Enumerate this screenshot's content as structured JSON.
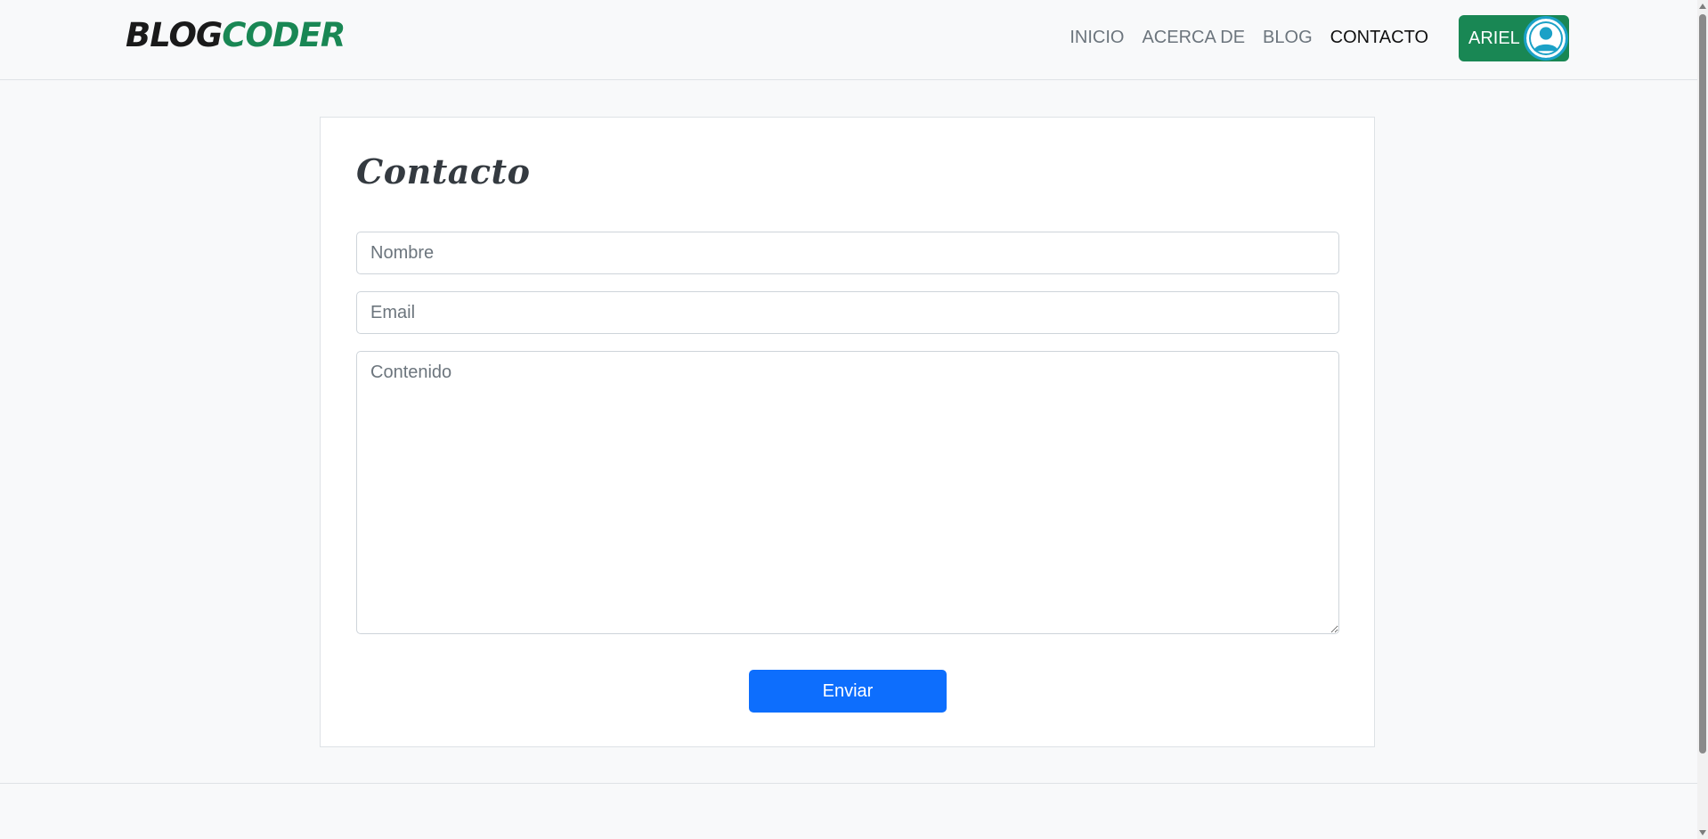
{
  "brand": {
    "part1": "BLOG",
    "part2": "CODER"
  },
  "nav": {
    "items": [
      {
        "label": "INICIO",
        "active": false
      },
      {
        "label": "ACERCA DE",
        "active": false
      },
      {
        "label": "BLOG",
        "active": false
      },
      {
        "label": "CONTACTO",
        "active": true
      }
    ]
  },
  "user": {
    "name": "ARIEL",
    "avatar_icon": "user-avatar-icon"
  },
  "form": {
    "title": "Contacto",
    "name_placeholder": "Nombre",
    "email_placeholder": "Email",
    "content_placeholder": "Contenido",
    "submit_label": "Enviar"
  },
  "colors": {
    "brand_accent": "#198754",
    "primary_button": "#0d6efd",
    "avatar_ring": "#1ba1c7"
  }
}
